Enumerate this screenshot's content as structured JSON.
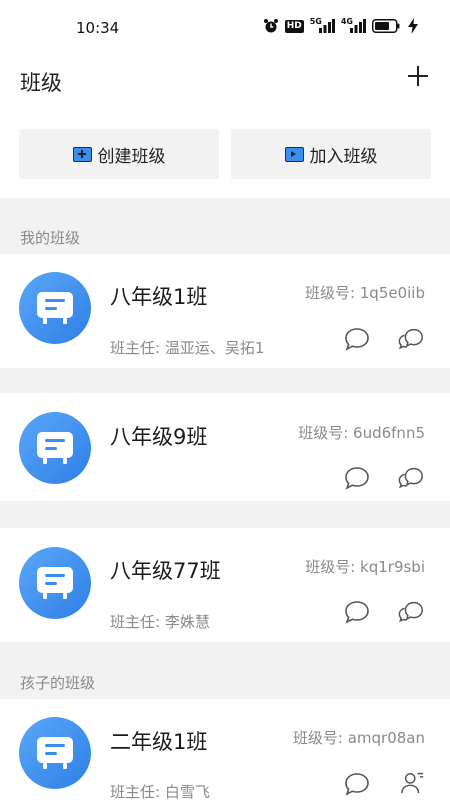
{
  "status_bar": {
    "time": "10:34",
    "hd_label": "HD",
    "net1": "5G",
    "net2": "4G"
  },
  "header": {
    "title": "班级",
    "create_label": "创建班级",
    "join_label": "加入班级"
  },
  "sections": {
    "my_classes": "我的班级",
    "child_classes": "孩子的班级"
  },
  "classes": [
    {
      "name": "八年级1班",
      "code": "班级号: 1q5e0iib",
      "teacher": "班主任: 温亚运、吴拓1"
    },
    {
      "name": "八年级9班",
      "code": "班级号: 6ud6fnn5",
      "teacher": ""
    },
    {
      "name": "八年级77班",
      "code": "班级号: kq1r9sbi",
      "teacher": "班主任: 李姝慧"
    },
    {
      "name": "二年级1班",
      "code": "班级号: amqr08an",
      "teacher": "班主任: 白雪飞"
    }
  ],
  "colors": {
    "accent": "#3a8ef0",
    "avatar_gradient_start": "#5aa7f8",
    "avatar_gradient_end": "#2f7fe6"
  }
}
